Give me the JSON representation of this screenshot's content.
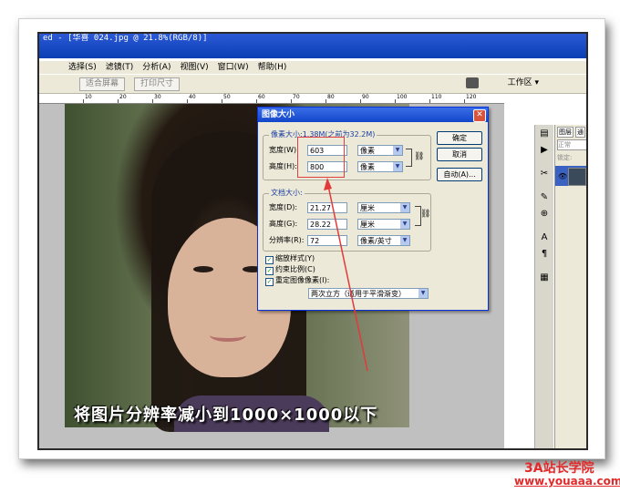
{
  "window": {
    "title": "ed - [华喜 024.jpg @ 21.8%(RGB/8)]"
  },
  "menu": [
    "选择(S)",
    "滤镜(T)",
    "分析(A)",
    "视图(V)",
    "窗口(W)",
    "帮助(H)"
  ],
  "options_bar": {
    "fit_screen": "适合屏幕",
    "print_size": "打印尺寸",
    "workspace": "工作区 ▾"
  },
  "ruler": {
    "ticks": [
      "10",
      "20",
      "30",
      "40",
      "50",
      "60",
      "70",
      "80",
      "90",
      "100",
      "110",
      "120"
    ]
  },
  "dialog": {
    "title": "图像大小",
    "pixel_dimensions": {
      "label": "像素大小:1.38M(之前为32.2M)",
      "width_label": "宽度(W):",
      "width_value": "603",
      "width_unit": "像素",
      "height_label": "高度(H):",
      "height_value": "800",
      "height_unit": "像素"
    },
    "document_size": {
      "label": "文档大小:",
      "width_label": "宽度(D):",
      "width_value": "21.27",
      "width_unit": "厘米",
      "height_label": "高度(G):",
      "height_value": "28.22",
      "height_unit": "厘米",
      "resolution_label": "分辨率(R):",
      "resolution_value": "72",
      "resolution_unit": "像素/英寸"
    },
    "buttons": {
      "ok": "确定",
      "cancel": "取消",
      "auto": "自动(A)..."
    },
    "checkboxes": [
      {
        "label": "缩放样式(Y)",
        "checked": true
      },
      {
        "label": "约束比例(C)",
        "checked": true
      },
      {
        "label": "重定图像像素(I):",
        "checked": true
      }
    ],
    "resample_method": "两次立方（适用于平滑渐变）"
  },
  "overlay_caption": "将图片分辨率减小到1000×1000以下",
  "layers_panel": {
    "tab1": "图层",
    "tab2": "通",
    "mode": "正常",
    "lock": "锁定:",
    "layer_name": "背"
  },
  "watermark": {
    "line1": "3A站长学院",
    "line2": "www.youaaa.com"
  },
  "colors": {
    "accent_red": "#e22a2a",
    "title_blue": "#0a3fb4"
  }
}
